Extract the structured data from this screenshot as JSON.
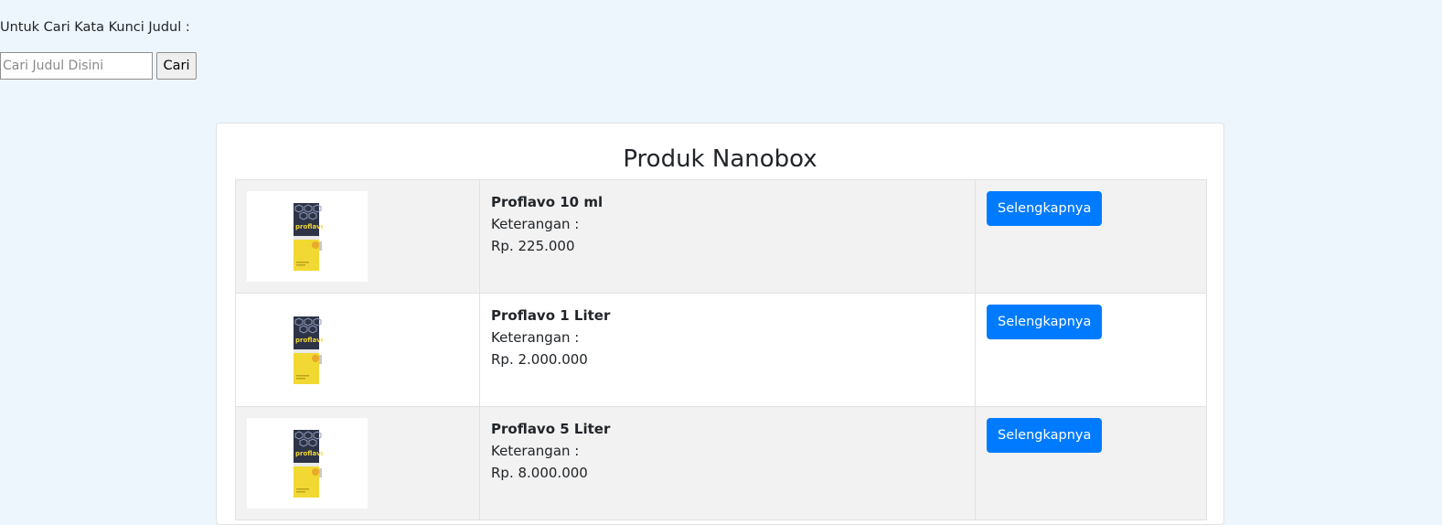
{
  "search": {
    "label": "Untuk Cari Kata Kunci Judul :",
    "placeholder": "Cari Judul Disini",
    "value": "",
    "button_label": "Cari"
  },
  "products_section": {
    "title": "Produk Nanobox",
    "items": [
      {
        "name": "Proflavo 10 ml",
        "description_label": "Keterangan :",
        "price": "Rp. 225.000",
        "button_label": "Selengkapnya",
        "image_icon": "proflavo-bottle-image"
      },
      {
        "name": "Proflavo 1 Liter",
        "description_label": "Keterangan :",
        "price": "Rp. 2.000.000",
        "button_label": "Selengkapnya",
        "image_icon": "proflavo-bottle-image"
      },
      {
        "name": "Proflavo 5 Liter",
        "description_label": "Keterangan :",
        "price": "Rp. 8.000.000",
        "button_label": "Selengkapnya",
        "image_icon": "proflavo-bottle-image"
      }
    ]
  },
  "colors": {
    "page_background": "#eef6fd",
    "primary_button": "#007bff",
    "striped_row": "#f2f2f2",
    "bottle_dark": "#2e3446",
    "bottle_yellow": "#f2d832"
  }
}
